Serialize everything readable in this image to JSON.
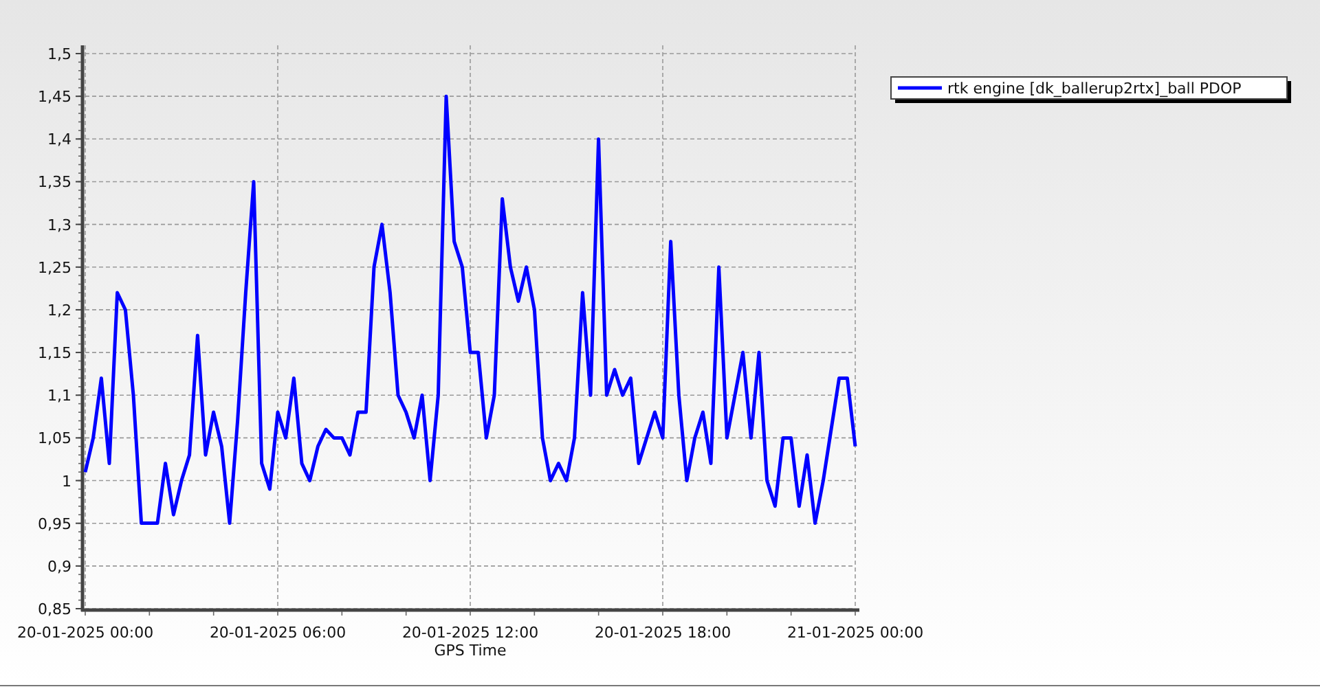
{
  "chart": {
    "chart_data": {
      "type": "line",
      "xlabel": "GPS Time",
      "categories": [
        "20-01-2025 00:00",
        null,
        null,
        null,
        null,
        null,
        null,
        null,
        null,
        null,
        null,
        null,
        null,
        null,
        null,
        null,
        null,
        null,
        null,
        null,
        null,
        null,
        null,
        null,
        "20-01-2025 06:00",
        null,
        null,
        null,
        null,
        null,
        null,
        null,
        null,
        null,
        null,
        null,
        null,
        null,
        null,
        null,
        null,
        null,
        null,
        null,
        null,
        null,
        null,
        null,
        "20-01-2025 12:00",
        null,
        null,
        null,
        null,
        null,
        null,
        null,
        null,
        null,
        null,
        null,
        null,
        null,
        null,
        null,
        null,
        null,
        null,
        null,
        null,
        null,
        null,
        null,
        "20-01-2025 18:00",
        null,
        null,
        null,
        null,
        null,
        null,
        null,
        null,
        null,
        null,
        null,
        null,
        null,
        null,
        null,
        null,
        null,
        null,
        null,
        null,
        null,
        null,
        null,
        "21-01-2025 00:00"
      ],
      "series": [
        {
          "name": "rtk engine [dk_ballerup2rtx]_ball PDOP",
          "color": "#0000ff",
          "values": [
            1.01,
            1.05,
            1.12,
            1.02,
            1.22,
            1.2,
            1.1,
            0.95,
            0.95,
            0.95,
            1.02,
            0.96,
            1.0,
            1.03,
            1.17,
            1.03,
            1.08,
            1.04,
            0.95,
            1.07,
            1.22,
            1.35,
            1.02,
            0.99,
            1.08,
            1.05,
            1.12,
            1.02,
            1.0,
            1.04,
            1.06,
            1.05,
            1.05,
            1.03,
            1.08,
            1.08,
            1.25,
            1.3,
            1.22,
            1.1,
            1.08,
            1.05,
            1.1,
            1.0,
            1.1,
            1.45,
            1.28,
            1.25,
            1.15,
            1.15,
            1.05,
            1.1,
            1.33,
            1.25,
            1.21,
            1.25,
            1.2,
            1.05,
            1.0,
            1.02,
            1.0,
            1.05,
            1.22,
            1.1,
            1.4,
            1.1,
            1.13,
            1.1,
            1.12,
            1.02,
            1.05,
            1.08,
            1.05,
            1.28,
            1.1,
            1.0,
            1.05,
            1.08,
            1.02,
            1.25,
            1.05,
            1.1,
            1.15,
            1.05,
            1.15,
            1.0,
            0.97,
            1.05,
            1.05,
            0.97,
            1.03,
            0.95,
            1.0,
            1.06,
            1.12,
            1.12,
            1.04
          ]
        }
      ],
      "grid": true,
      "ylim": [
        0.85,
        1.5
      ],
      "yticks": [
        {
          "value": 0.85,
          "label": "0,85"
        },
        {
          "value": 0.9,
          "label": "0,9"
        },
        {
          "value": 0.95,
          "label": "0,95"
        },
        {
          "value": 1,
          "label": "1"
        },
        {
          "value": 1.05,
          "label": "1,05"
        },
        {
          "value": 1.1,
          "label": "1,1"
        },
        {
          "value": 1.15,
          "label": "1,15"
        },
        {
          "value": 1.2,
          "label": "1,2"
        },
        {
          "value": 1.25,
          "label": "1,25"
        },
        {
          "value": 1.3,
          "label": "1,3"
        },
        {
          "value": 1.35,
          "label": "1,35"
        },
        {
          "value": 1.4,
          "label": "1,4"
        },
        {
          "value": 1.45,
          "label": "1,45"
        },
        {
          "value": 1.5,
          "label": "1,5"
        }
      ]
    }
  }
}
